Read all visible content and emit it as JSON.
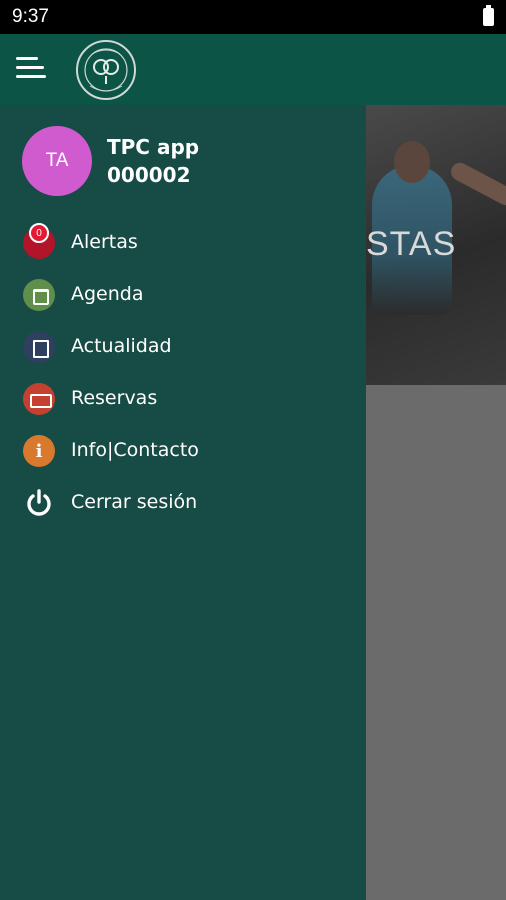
{
  "status_bar": {
    "time": "9:37"
  },
  "hero": {
    "text": "STAS"
  },
  "user": {
    "initials": "TA",
    "name": "TPC app",
    "id": "000002"
  },
  "menu": [
    {
      "label": "Alertas",
      "icon": "bell-icon",
      "badge": "0"
    },
    {
      "label": "Agenda",
      "icon": "calendar-icon"
    },
    {
      "label": "Actualidad",
      "icon": "news-icon"
    },
    {
      "label": "Reservas",
      "icon": "keyboard-icon"
    },
    {
      "label": "Info|Contacto",
      "icon": "info-icon",
      "glyph": "i"
    },
    {
      "label": "Cerrar sesión",
      "icon": "power-icon"
    }
  ],
  "colors": {
    "app_bar": "#0b5446",
    "drawer": "#174b45",
    "avatar": "#cf5bcf"
  }
}
